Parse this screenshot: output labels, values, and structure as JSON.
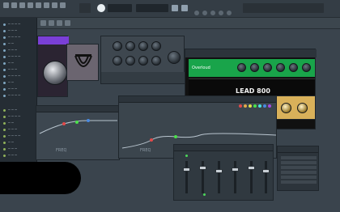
{
  "colors": {
    "background": "#3a444d",
    "amp_green": "#19a44a",
    "amp_black": "#111111",
    "accent_purple": "#7a3fd6",
    "gold": "#d9b15a"
  },
  "menubar": {
    "icons": [
      "file-icon",
      "edit-icon",
      "add-icon",
      "patterns-icon",
      "view-icon",
      "options-icon",
      "tools-icon",
      "help-icon"
    ]
  },
  "amp": {
    "brand": "Overloud",
    "model": "LEAD 800"
  },
  "eq": {
    "freq_label": "FREQ",
    "freq_label_2": "FREQ"
  }
}
